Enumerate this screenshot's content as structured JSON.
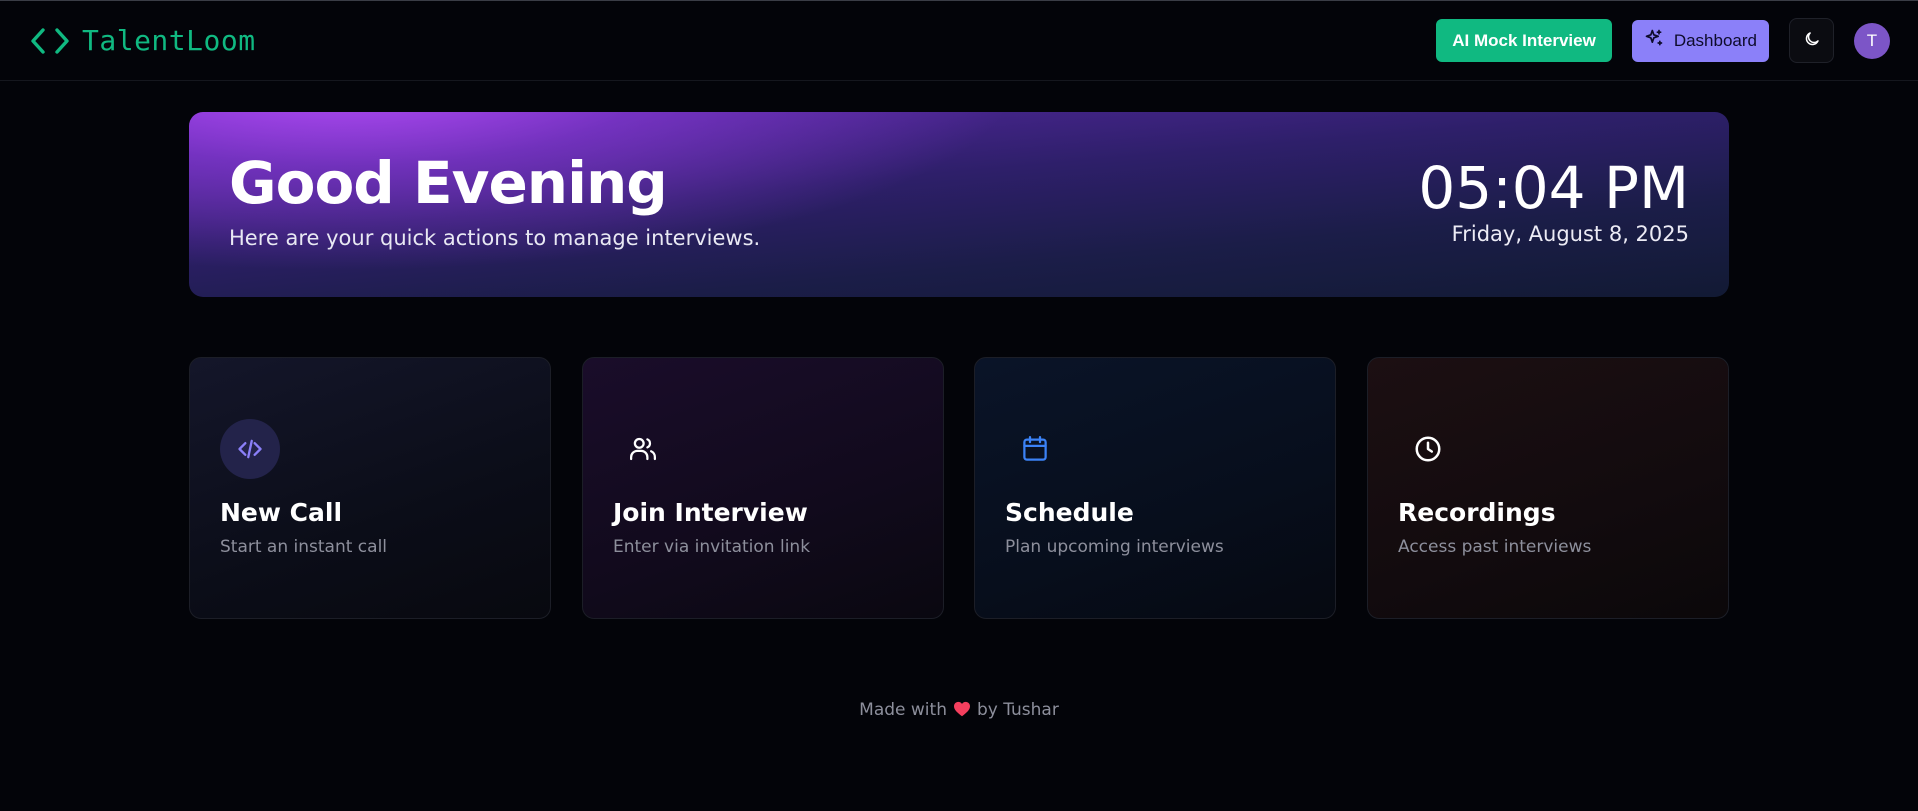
{
  "app": {
    "brand_name": "TalentLoom"
  },
  "header": {
    "mock_interview_label": "AI Mock Interview",
    "dashboard_label": "Dashboard",
    "avatar_initial": "T"
  },
  "hero": {
    "greeting": "Good Evening",
    "subtitle": "Here are your quick actions to manage interviews.",
    "time": "05:04 PM",
    "date": "Friday, August 8, 2025"
  },
  "actions": [
    {
      "title": "New Call",
      "description": "Start an instant call",
      "icon": "code-icon",
      "color": "#8b80f9"
    },
    {
      "title": "Join Interview",
      "description": "Enter via invitation link",
      "icon": "users-icon",
      "color": "#ffffff"
    },
    {
      "title": "Schedule",
      "description": "Plan upcoming interviews",
      "icon": "calendar-icon",
      "color": "#3b82f6"
    },
    {
      "title": "Recordings",
      "description": "Access past interviews",
      "icon": "clock-icon",
      "color": "#ffffff"
    }
  ],
  "footer": {
    "made_with": "Made with",
    "by": "by Tushar"
  },
  "colors": {
    "accent_green": "#10b981",
    "accent_purple": "#8b80f9",
    "background": "#030409"
  }
}
